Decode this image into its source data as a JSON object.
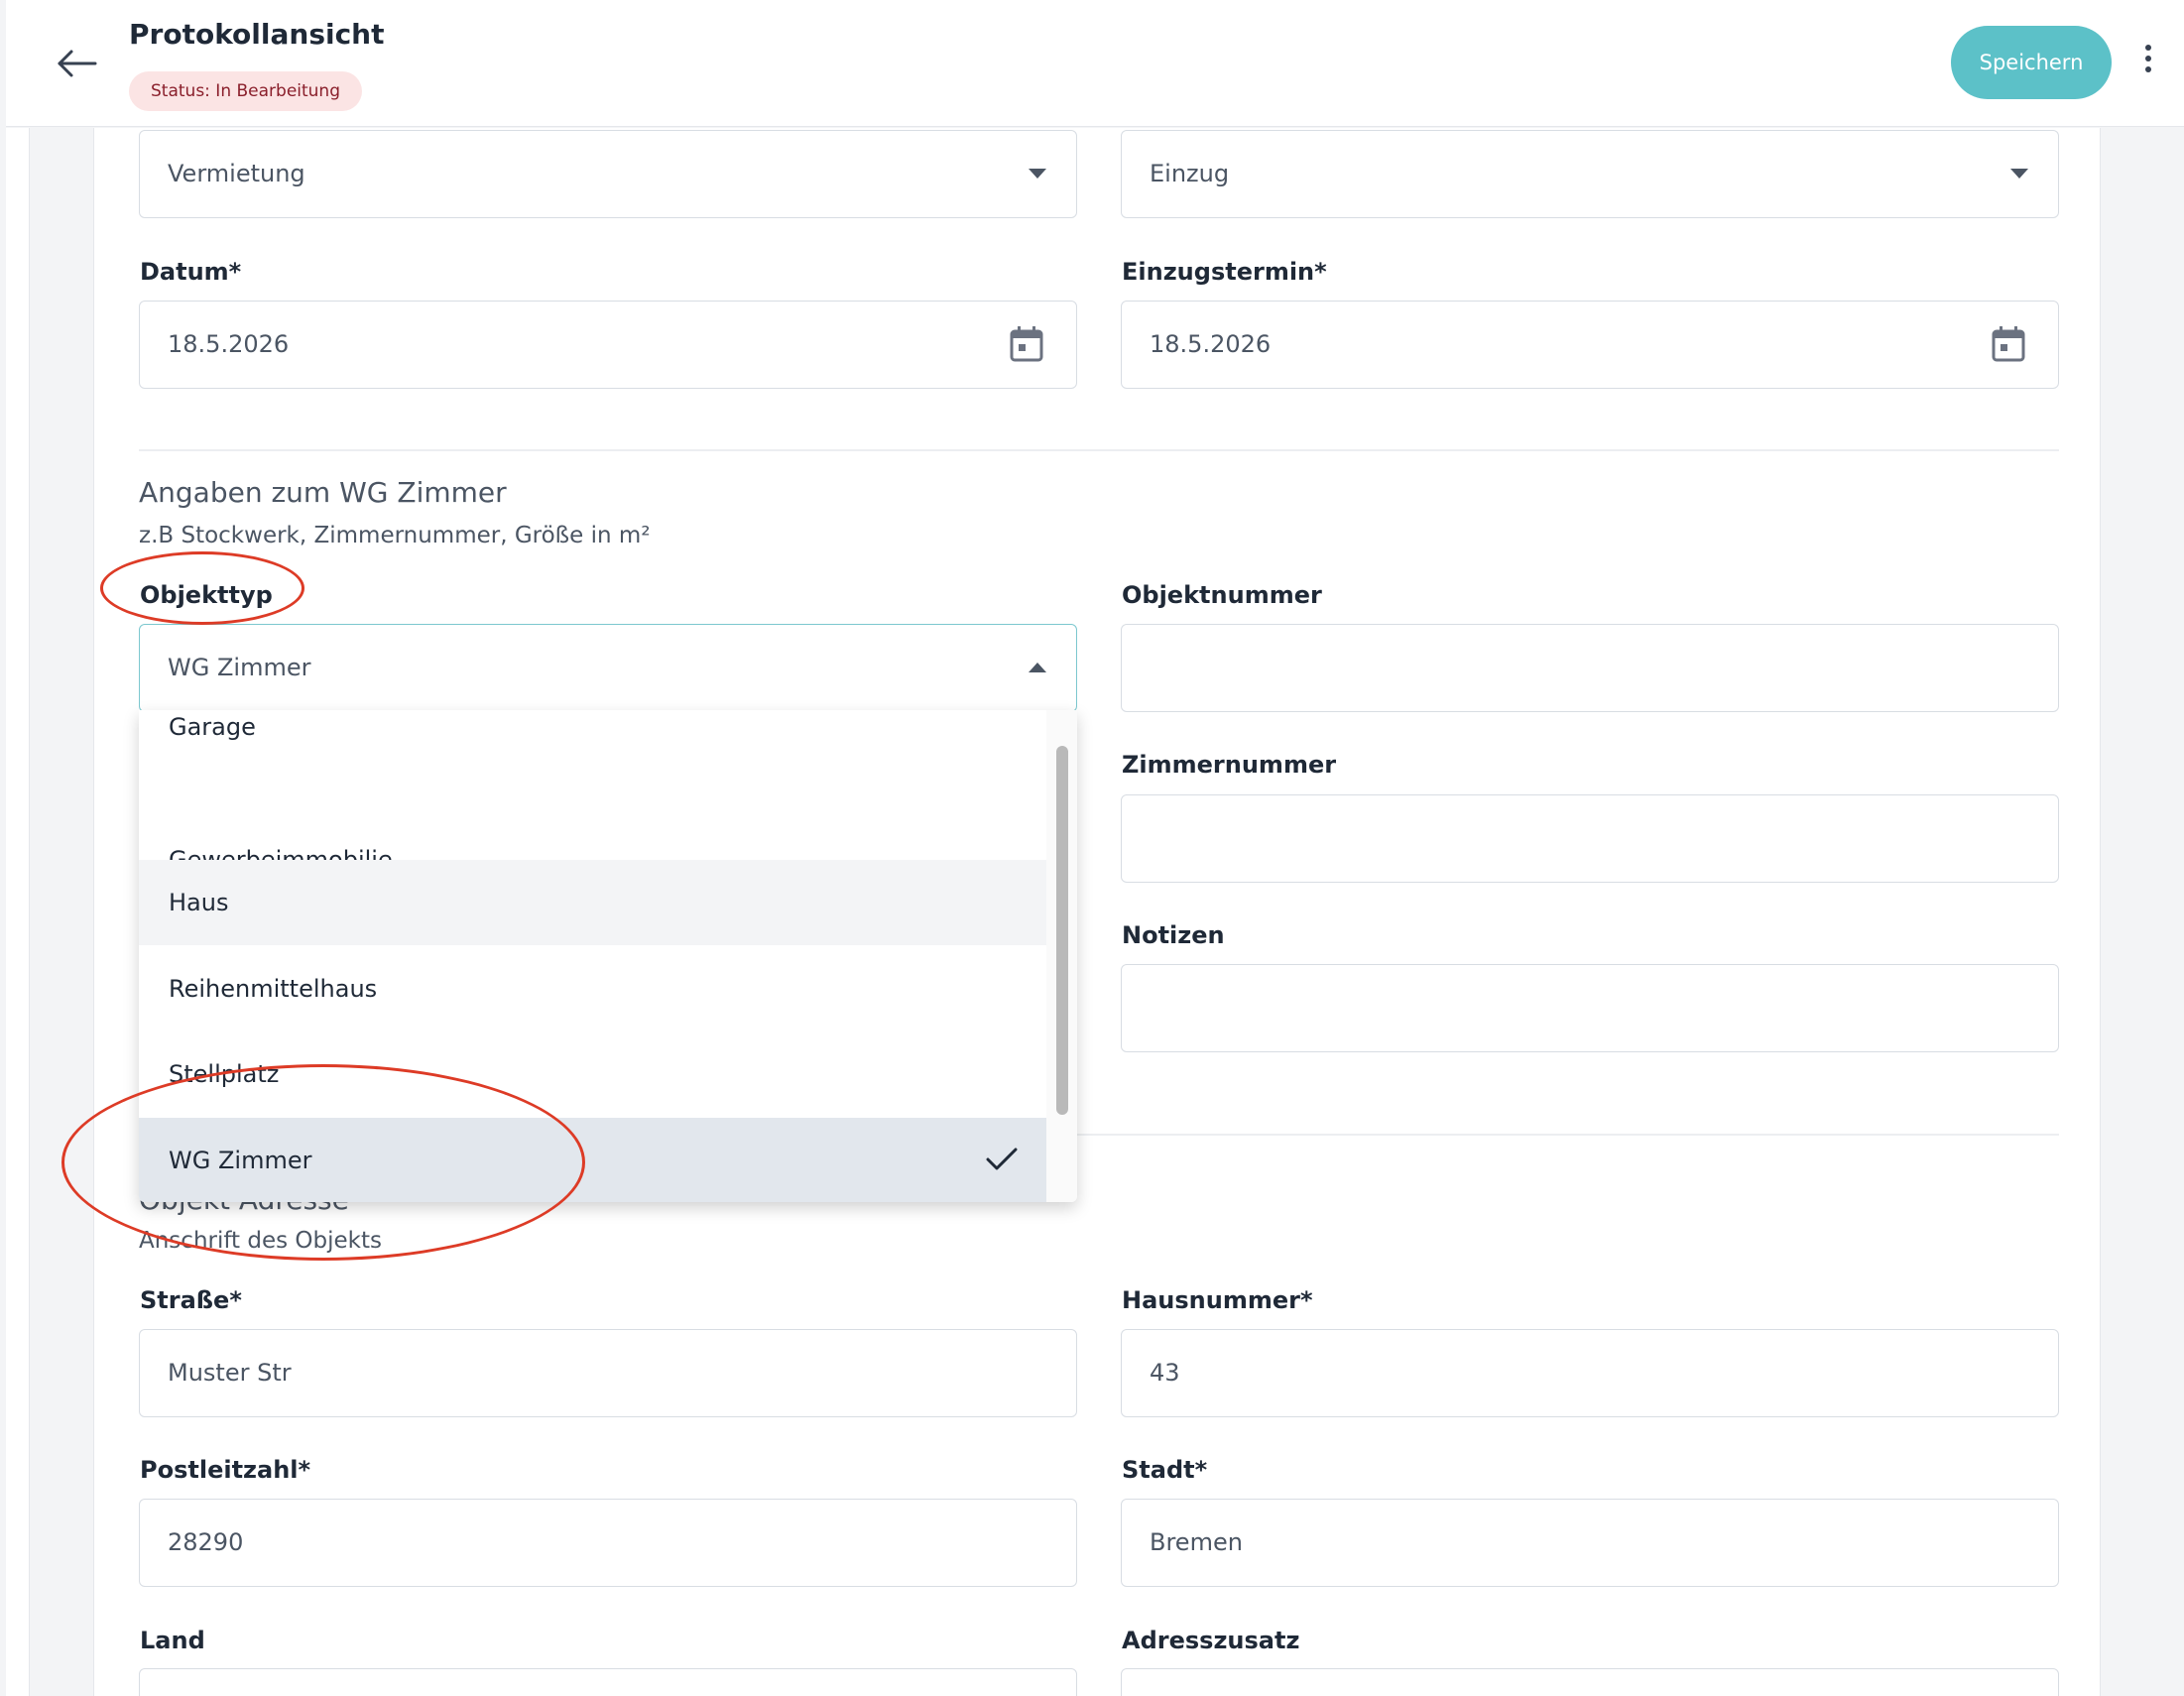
{
  "header": {
    "back_icon": "arrow-left-icon",
    "title": "Protokollansicht",
    "status_badge": "Status:  In Bearbeitung",
    "save_label": "Speichern",
    "more_icon": "more-vertical-icon"
  },
  "top_selects": {
    "left_value": "Vermietung",
    "right_value": "Einzug"
  },
  "dates": {
    "datum_label": "Datum*",
    "datum_value": "18.5.2026",
    "einzug_label": "Einzugstermin*",
    "einzug_value": "18.5.2026"
  },
  "wg_section": {
    "title": "Angaben zum WG Zimmer",
    "subtitle": "z.B Stockwerk, Zimmernummer, Größe in m²",
    "objekttyp_label": "Objekttyp",
    "objekttyp_value": "WG Zimmer",
    "objektnummer_label": "Objektnummer",
    "zimmernummer_label": "Zimmernummer",
    "notizen_label": "Notizen"
  },
  "dropdown": {
    "options": [
      "Garage",
      "Gewerbeimmobilie",
      "Haus",
      "Reihenmittelhaus",
      "Stellplatz",
      "WG Zimmer"
    ],
    "hovered": "Haus",
    "selected": "WG Zimmer"
  },
  "address_section": {
    "title": "Objekt Adresse",
    "subtitle": "Anschrift des Objekts",
    "strasse_label": "Straße*",
    "strasse_value": "Muster Str",
    "hausnummer_label": "Hausnummer*",
    "hausnummer_value": "43",
    "plz_label": "Postleitzahl*",
    "plz_value": "28290",
    "stadt_label": "Stadt*",
    "stadt_value": "Bremen",
    "land_label": "Land",
    "adresszusatz_label": "Adresszusatz"
  },
  "colors": {
    "accent": "#5cc1c8",
    "badge_bg": "#fbe4e4",
    "badge_text": "#8a1f2b",
    "annotation": "#dd3b26"
  }
}
